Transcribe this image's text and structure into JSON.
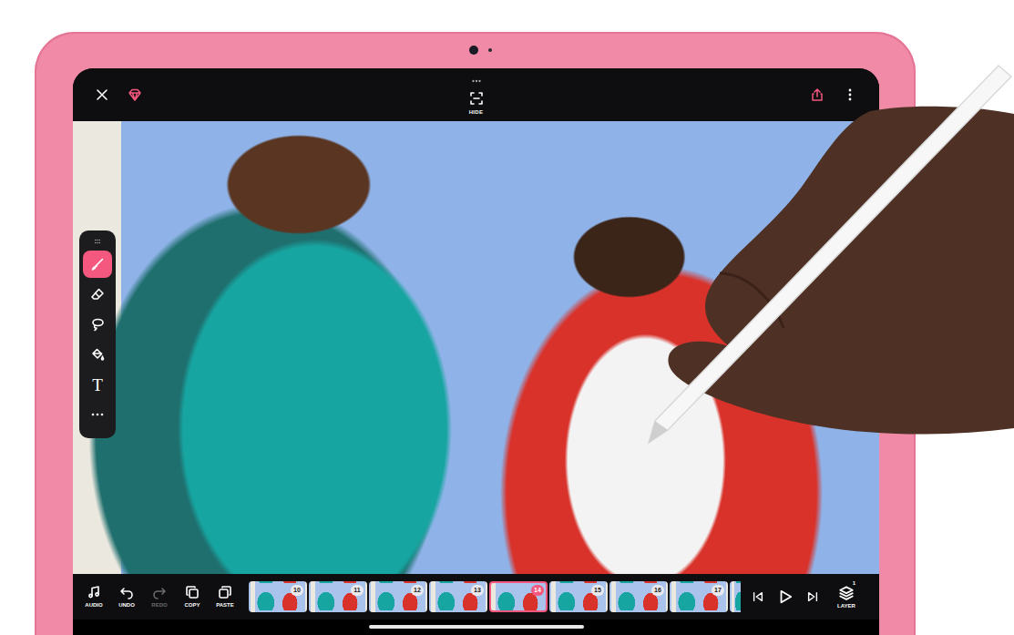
{
  "top_bar": {
    "hide_label": "HIDE"
  },
  "tools": [
    {
      "kind": "brush",
      "selected": true
    },
    {
      "kind": "eraser",
      "selected": false
    },
    {
      "kind": "lasso",
      "selected": false
    },
    {
      "kind": "fill",
      "selected": false
    },
    {
      "kind": "text",
      "label": "T",
      "selected": false
    },
    {
      "kind": "more",
      "selected": false
    }
  ],
  "bottom_bar": {
    "buttons": [
      {
        "kind": "audio",
        "label": "AUDIO",
        "disabled": false
      },
      {
        "kind": "undo",
        "label": "UNDO",
        "disabled": false
      },
      {
        "kind": "redo",
        "label": "REDO",
        "disabled": true
      },
      {
        "kind": "copy",
        "label": "COPY",
        "disabled": false
      },
      {
        "kind": "paste",
        "label": "PASTE",
        "disabled": false
      }
    ],
    "frames": [
      {
        "number": "10",
        "selected": false
      },
      {
        "number": "11",
        "selected": false
      },
      {
        "number": "12",
        "selected": false
      },
      {
        "number": "13",
        "selected": false
      },
      {
        "number": "14",
        "selected": true
      },
      {
        "number": "15",
        "selected": false
      },
      {
        "number": "16",
        "selected": false
      },
      {
        "number": "17",
        "selected": false
      }
    ],
    "layer": {
      "label": "LAYER",
      "count": "1"
    }
  }
}
